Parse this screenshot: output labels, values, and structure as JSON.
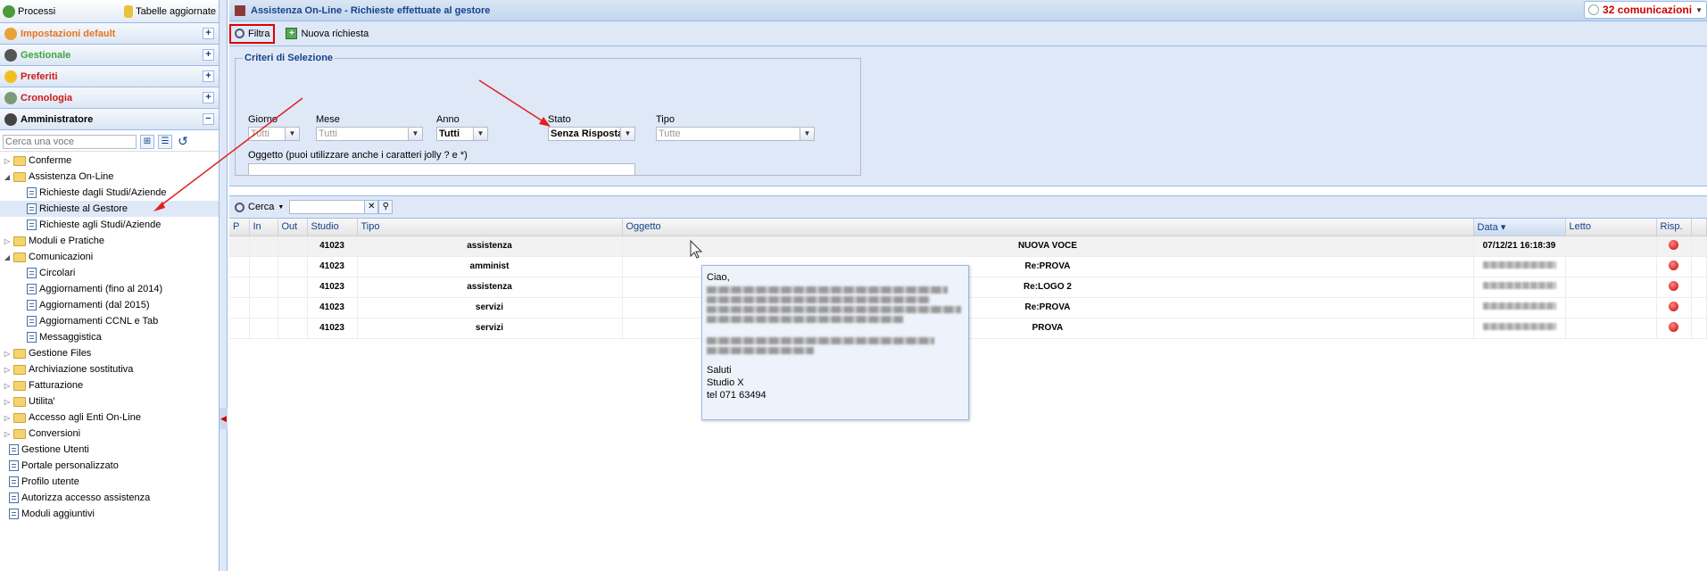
{
  "left": {
    "top_processi": "Processi",
    "top_tabelle": "Tabelle aggiornate",
    "accordion": [
      {
        "label": "Impostazioni default",
        "color": "#e8731a",
        "btn": "+"
      },
      {
        "label": "Gestionale",
        "color": "#3aa83a",
        "btn": "+"
      },
      {
        "label": "Preferiti",
        "color": "#d01818",
        "btn": "+"
      },
      {
        "label": "Cronologia",
        "color": "#d01818",
        "btn": "+"
      },
      {
        "label": "Amministratore",
        "color": "#000000",
        "btn": "−"
      }
    ],
    "search_placeholder": "Cerca una voce",
    "tree": [
      {
        "label": "Conferme",
        "type": "folder",
        "level": 0,
        "toggle": "▷"
      },
      {
        "label": "Assistenza On-Line",
        "type": "folder",
        "level": 0,
        "toggle": "◢"
      },
      {
        "label": "Richieste dagli Studi/Aziende",
        "type": "leaf",
        "level": 1,
        "toggle": ""
      },
      {
        "label": "Richieste al Gestore",
        "type": "leaf",
        "level": 1,
        "toggle": "",
        "selected": true
      },
      {
        "label": "Richieste agli Studi/Aziende",
        "type": "leaf",
        "level": 1,
        "toggle": ""
      },
      {
        "label": "Moduli e Pratiche",
        "type": "folder",
        "level": 0,
        "toggle": "▷"
      },
      {
        "label": "Comunicazioni",
        "type": "folder",
        "level": 0,
        "toggle": "◢"
      },
      {
        "label": "Circolari",
        "type": "leaf",
        "level": 1,
        "toggle": ""
      },
      {
        "label": "Aggiornamenti (fino al 2014)",
        "type": "leaf",
        "level": 1,
        "toggle": ""
      },
      {
        "label": "Aggiornamenti (dal 2015)",
        "type": "leaf",
        "level": 1,
        "toggle": ""
      },
      {
        "label": "Aggiornamenti CCNL e Tab",
        "type": "leaf",
        "level": 1,
        "toggle": ""
      },
      {
        "label": "Messaggistica",
        "type": "leaf",
        "level": 1,
        "toggle": ""
      },
      {
        "label": "Gestione Files",
        "type": "folder",
        "level": 0,
        "toggle": "▷"
      },
      {
        "label": "Archiviazione sostitutiva",
        "type": "folder",
        "level": 0,
        "toggle": "▷"
      },
      {
        "label": "Fatturazione",
        "type": "folder",
        "level": 0,
        "toggle": "▷"
      },
      {
        "label": "Utilita'",
        "type": "folder",
        "level": 0,
        "toggle": "▷"
      },
      {
        "label": "Accesso agli Enti On-Line",
        "type": "folder",
        "level": 0,
        "toggle": "▷"
      },
      {
        "label": "Conversioni",
        "type": "folder",
        "level": 0,
        "toggle": "▷"
      },
      {
        "label": "Gestione Utenti",
        "type": "leaf",
        "level": 0,
        "toggle": ""
      },
      {
        "label": "Portale personalizzato",
        "type": "leaf",
        "level": 0,
        "toggle": ""
      },
      {
        "label": "Profilo utente",
        "type": "leaf",
        "level": 0,
        "toggle": ""
      },
      {
        "label": "Autorizza accesso assistenza",
        "type": "leaf",
        "level": 0,
        "toggle": ""
      },
      {
        "label": "Moduli aggiuntivi",
        "type": "leaf",
        "level": 0,
        "toggle": ""
      }
    ]
  },
  "main": {
    "title": "Assistenza On-Line - Richieste effettuate al gestore",
    "communications": "32 comunicazioni",
    "toolbar": {
      "filter": "Filtra",
      "new_request": "Nuova richiesta"
    },
    "filter": {
      "legend": "Criteri di Selezione",
      "giorno_label": "Giorno",
      "giorno_value": "Tutti",
      "mese_label": "Mese",
      "mese_value": "Tutti",
      "anno_label": "Anno",
      "anno_value": "Tutti",
      "stato_label": "Stato",
      "stato_value": "Senza Risposta",
      "tipo_label": "Tipo",
      "tipo_value": "Tutte",
      "oggetto_label": "Oggetto (puoi utilizzare anche i caratteri jolly ? e *)"
    },
    "gridbar": {
      "search": "Cerca"
    },
    "columns": [
      "P",
      "In",
      "Out",
      "Studio",
      "Tipo",
      "Oggetto",
      "Data",
      "Letto",
      "Risp."
    ],
    "sort_indicator": "▾",
    "rows": [
      {
        "studio": "41023",
        "tipo": "assistenza",
        "oggetto": "NUOVA VOCE",
        "data": "07/12/21 16:18:39"
      },
      {
        "studio": "41023",
        "tipo": "amminist",
        "oggetto": "Re:PROVA",
        "data": ""
      },
      {
        "studio": "41023",
        "tipo": "assistenza",
        "oggetto": "Re:LOGO 2",
        "data": ""
      },
      {
        "studio": "41023",
        "tipo": "servizi",
        "oggetto": "Re:PROVA",
        "data": ""
      },
      {
        "studio": "41023",
        "tipo": "servizi",
        "oggetto": "PROVA",
        "data": ""
      }
    ],
    "tooltip": {
      "greeting": "Ciao,",
      "sign1": "Saluti",
      "sign2": "Studio X",
      "sign3": "tel 071 63494"
    }
  }
}
